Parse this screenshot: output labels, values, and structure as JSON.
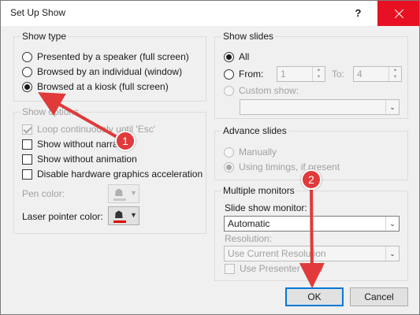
{
  "window": {
    "title": "Set Up Show",
    "help_label": "?"
  },
  "show_type": {
    "title": "Show type",
    "options": [
      {
        "label": "Presented by a speaker (full screen)",
        "selected": false
      },
      {
        "label": "Browsed by an individual (window)",
        "selected": false
      },
      {
        "label": "Browsed at a kiosk (full screen)",
        "selected": true
      }
    ]
  },
  "show_options": {
    "title": "Show options",
    "checkboxes": [
      {
        "label": "Loop continuously until 'Esc'",
        "checked": true,
        "disabled": true
      },
      {
        "label": "Show without narration",
        "checked": false,
        "disabled": false
      },
      {
        "label": "Show without animation",
        "checked": false,
        "disabled": false
      },
      {
        "label": "Disable hardware graphics acceleration",
        "checked": false,
        "disabled": false
      }
    ],
    "pen_color_label": "Pen color:",
    "laser_pointer_color_label": "Laser pointer color:",
    "laser_pointer_color": "#e00000"
  },
  "show_slides": {
    "title": "Show slides",
    "all_label": "All",
    "from_label": "From:",
    "from_value": "1",
    "to_label": "To:",
    "to_value": "4",
    "custom_show_label": "Custom show:",
    "custom_show_value": "",
    "selected": "All"
  },
  "advance_slides": {
    "title": "Advance slides",
    "manually_label": "Manually",
    "timings_label": "Using timings, if present",
    "selected": "Using timings, if present"
  },
  "multiple_monitors": {
    "title": "Multiple monitors",
    "monitor_label": "Slide show monitor:",
    "monitor_value": "Automatic",
    "resolution_label": "Resolution:",
    "resolution_value": "Use Current Resolution",
    "presenter_view_label": "Use Presenter View",
    "presenter_view_checked": false
  },
  "buttons": {
    "ok_label": "OK",
    "cancel_label": "Cancel"
  },
  "annotations": [
    {
      "number": "1",
      "color": "#e03a3a"
    },
    {
      "number": "2",
      "color": "#e03a3a"
    }
  ]
}
